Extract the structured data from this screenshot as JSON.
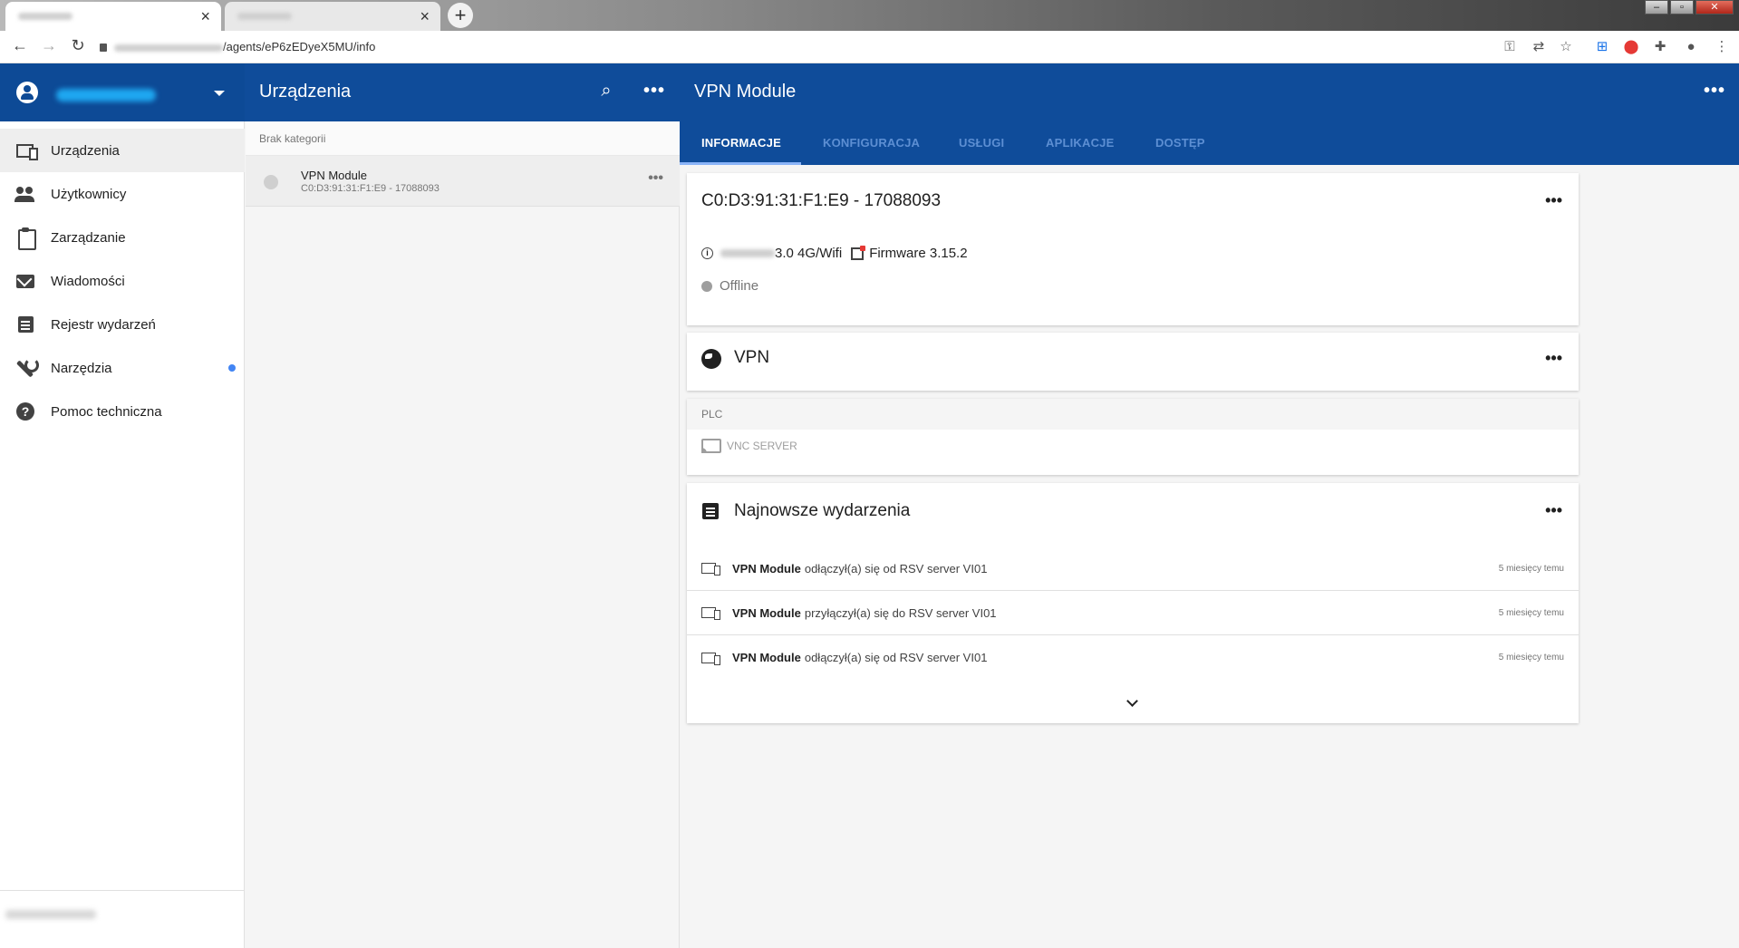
{
  "browser": {
    "tab_close": "×",
    "new_tab": "+",
    "url_path": "/agents/eP6zEDyeX5MU/info",
    "window_controls": [
      "–",
      "▫",
      "✕"
    ]
  },
  "header": {
    "middle_title": "Urządzenia",
    "right_title": "VPN Module"
  },
  "tabs": [
    {
      "label": "INFORMACJE",
      "active": true
    },
    {
      "label": "KONFIGURACJA",
      "active": false
    },
    {
      "label": "USŁUGI",
      "active": false
    },
    {
      "label": "APLIKACJE",
      "active": false
    },
    {
      "label": "DOSTĘP",
      "active": false
    }
  ],
  "sidebar": {
    "items": [
      {
        "label": "Urządzenia",
        "icon": "devices-icon",
        "active": true
      },
      {
        "label": "Użytkownicy",
        "icon": "users-icon"
      },
      {
        "label": "Zarządzanie",
        "icon": "clipboard-icon"
      },
      {
        "label": "Wiadomości",
        "icon": "mail-icon"
      },
      {
        "label": "Rejestr wydarzeń",
        "icon": "event-log-icon"
      },
      {
        "label": "Narzędzia",
        "icon": "wrench-icon",
        "badge": true
      },
      {
        "label": "Pomoc techniczna",
        "icon": "help-icon"
      }
    ],
    "badge_color": "#4285f4"
  },
  "device_list": {
    "category": "Brak kategorii",
    "items": [
      {
        "name": "VPN Module",
        "sub": "C0:D3:91:31:F1:E9 - 17088093"
      }
    ]
  },
  "info_card": {
    "title": "C0:D3:91:31:F1:E9 - 17088093",
    "model_suffix": "3.0 4G/Wifi",
    "firmware": "Firmware 3.15.2",
    "status": "Offline"
  },
  "vpn_card": {
    "title": "VPN"
  },
  "plc": {
    "header": "PLC",
    "service": "VNC SERVER"
  },
  "events_card": {
    "title": "Najnowsze wydarzenia",
    "events": [
      {
        "device": "VPN Module",
        "text": "odłączył(a) się od RSV server VI01",
        "time": "5 miesięcy temu"
      },
      {
        "device": "VPN Module",
        "text": "przyłączył(a) się do RSV server VI01",
        "time": "5 miesięcy temu"
      },
      {
        "device": "VPN Module",
        "text": "odłączył(a) się od RSV server VI01",
        "time": "5 miesięcy temu"
      }
    ]
  },
  "colors": {
    "header_blue": "#0f4c9a",
    "tab_inactive": "#5d8fd3"
  },
  "more_label": "•••"
}
